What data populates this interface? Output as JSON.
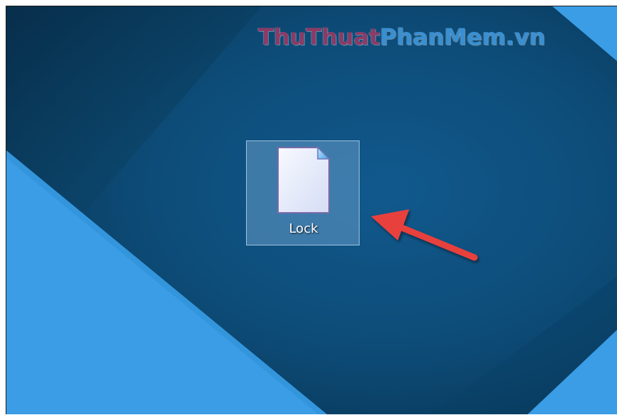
{
  "watermark": {
    "part1": "ThuThuat",
    "part2": "PhanMem.vn"
  },
  "desktop_icon": {
    "label": "Lock",
    "icon": "blank-text-file-icon",
    "selected": true
  },
  "annotation": {
    "icon": "red-arrow-icon",
    "color": "#e8413c"
  },
  "colors": {
    "wallpaper_dark": "#0e4f7d",
    "wallpaper_light": "#3a9de6",
    "selection": "#78aad7"
  }
}
